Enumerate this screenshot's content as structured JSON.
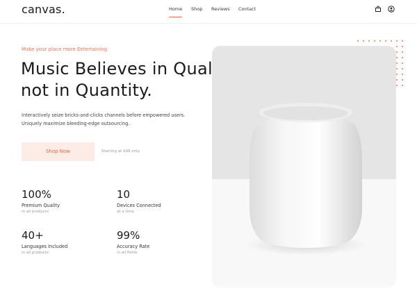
{
  "brand": {
    "name": "canvas",
    "dot": "."
  },
  "nav": {
    "items": [
      {
        "label": "Home",
        "active": true
      },
      {
        "label": "Shop",
        "active": false
      },
      {
        "label": "Reviews",
        "active": false
      },
      {
        "label": "Contact",
        "active": false
      }
    ],
    "icons": [
      "bag-icon",
      "user-icon"
    ]
  },
  "hero": {
    "tagline": "Make your place more Entertaining",
    "headline_line1": "Music Believes in Quality",
    "headline_line2": "not in Quantity.",
    "description": "Interactively seize bricks-and-clicks channels before empowered users. Uniquely maximize bleeding-edge outsourcing.",
    "cta_label": "Shop Now",
    "starting_note": "Starting at $99 only."
  },
  "stats": [
    {
      "value": "100%",
      "label": "Premium Quality",
      "sub": "in all products"
    },
    {
      "value": "10",
      "label": "Devices Connected",
      "sub": "at a time"
    },
    {
      "value": "40+",
      "label": "Languages Included",
      "sub": "in all products"
    },
    {
      "value": "99%",
      "label": "Accuracy Rate",
      "sub": "in all fields"
    }
  ],
  "colors": {
    "accent": "#f07050",
    "button_bg": "#fdece5",
    "text_dark": "#1a1a1a",
    "text_muted": "#9a9a9a",
    "card_top": "#e5e5e5",
    "card_bottom": "#f8f8f8"
  }
}
